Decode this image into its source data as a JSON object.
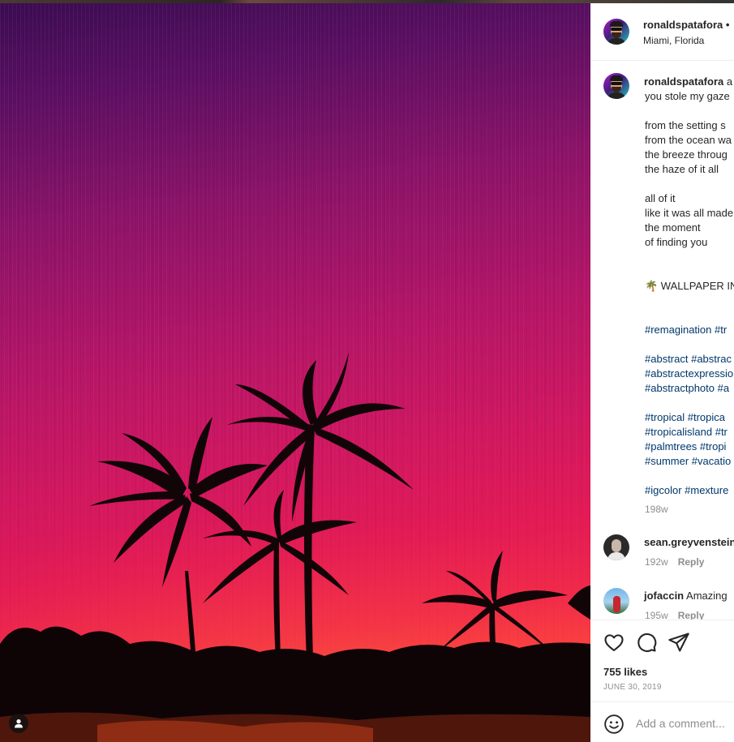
{
  "post": {
    "username": "ronaldspatafora",
    "location": "Miami, Florida",
    "follow_dot": "•",
    "caption": {
      "username_suffix": " a",
      "lines_a": [
        "you stole my gaze"
      ],
      "lines_b": [
        "from the setting s",
        "from the ocean wa",
        "the breeze throug",
        "the haze of it all"
      ],
      "lines_c": [
        "all of it",
        "like it was all made",
        "the moment",
        "of finding you"
      ],
      "wallpaper": "🌴 WALLPAPER IN",
      "hashtag_groups": [
        [
          "#remagination #tr"
        ],
        [
          "#abstract #abstrac",
          "#abstractexpressio",
          "#abstractphoto #a"
        ],
        [
          "#tropical #tropica",
          "#tropicalisland #tr",
          "#palmtrees #tropi",
          "#summer #vacatio"
        ],
        [
          "#igcolor #mexture"
        ]
      ],
      "age": "198w"
    },
    "comments": [
      {
        "username": "sean.greyvenstein",
        "text": "",
        "age": "192w",
        "reply": "Reply"
      },
      {
        "username": "jofaccin",
        "text": "Amazing",
        "age": "195w",
        "reply": "Reply"
      }
    ],
    "likes": "755 likes",
    "date": "JUNE 30, 2019",
    "add_comment_placeholder": "Add a comment..."
  },
  "icons": {
    "like": "heart-icon",
    "comment": "comment-bubble-icon",
    "share": "paper-plane-icon",
    "emoji": "smiley-icon",
    "tag": "user-tag-icon"
  },
  "colors": {
    "hashtag": "#00376b",
    "muted": "#8e8e8e",
    "text": "#262626",
    "divider": "#efefef"
  }
}
